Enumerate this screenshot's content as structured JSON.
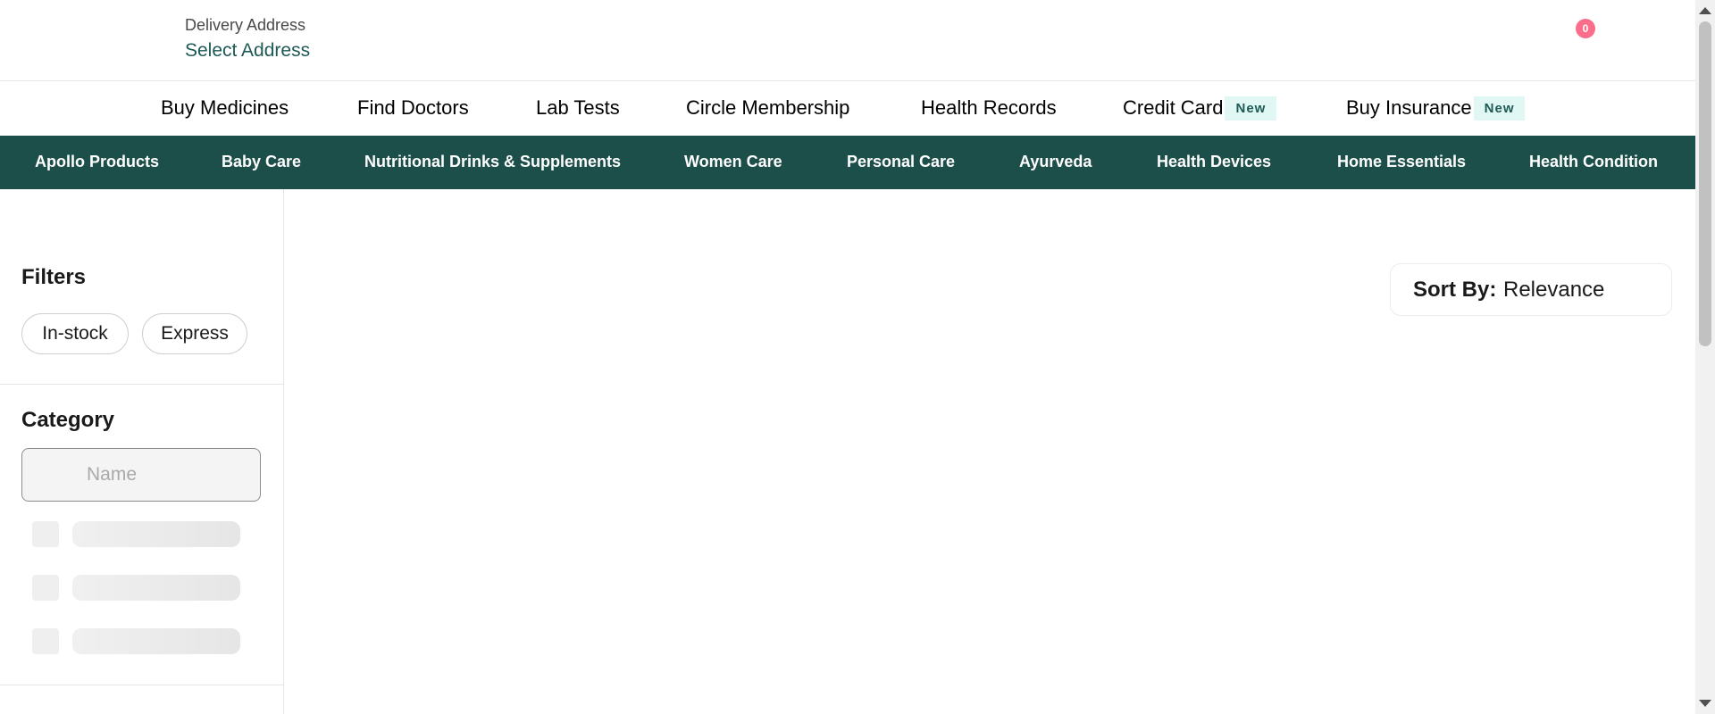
{
  "header": {
    "delivery_label": "Delivery Address",
    "delivery_value": "Select Address",
    "cart_count": "0"
  },
  "primary_nav": [
    {
      "label": "Buy Medicines"
    },
    {
      "label": "Find Doctors"
    },
    {
      "label": "Lab Tests"
    },
    {
      "label": "Circle Membership"
    },
    {
      "label": "Health Records"
    },
    {
      "label": "Credit Card",
      "badge": "New"
    },
    {
      "label": "Buy Insurance",
      "badge": "New"
    }
  ],
  "category_bar": [
    "Apollo Products",
    "Baby Care",
    "Nutritional Drinks & Supplements",
    "Women Care",
    "Personal Care",
    "Ayurveda",
    "Health Devices",
    "Home Essentials",
    "Health Condition"
  ],
  "filters": {
    "title": "Filters",
    "chips": [
      "In-stock",
      "Express"
    ]
  },
  "category": {
    "title": "Category",
    "search_placeholder": "Name",
    "search_value": ""
  },
  "sort": {
    "label": "Sort By:",
    "value": "Relevance"
  },
  "colors": {
    "brand_dark": "#1c4f4a",
    "accent_teal": "#1d5a55",
    "badge_bg": "#e0f7f4",
    "cart_badge": "#fb6e8b"
  }
}
